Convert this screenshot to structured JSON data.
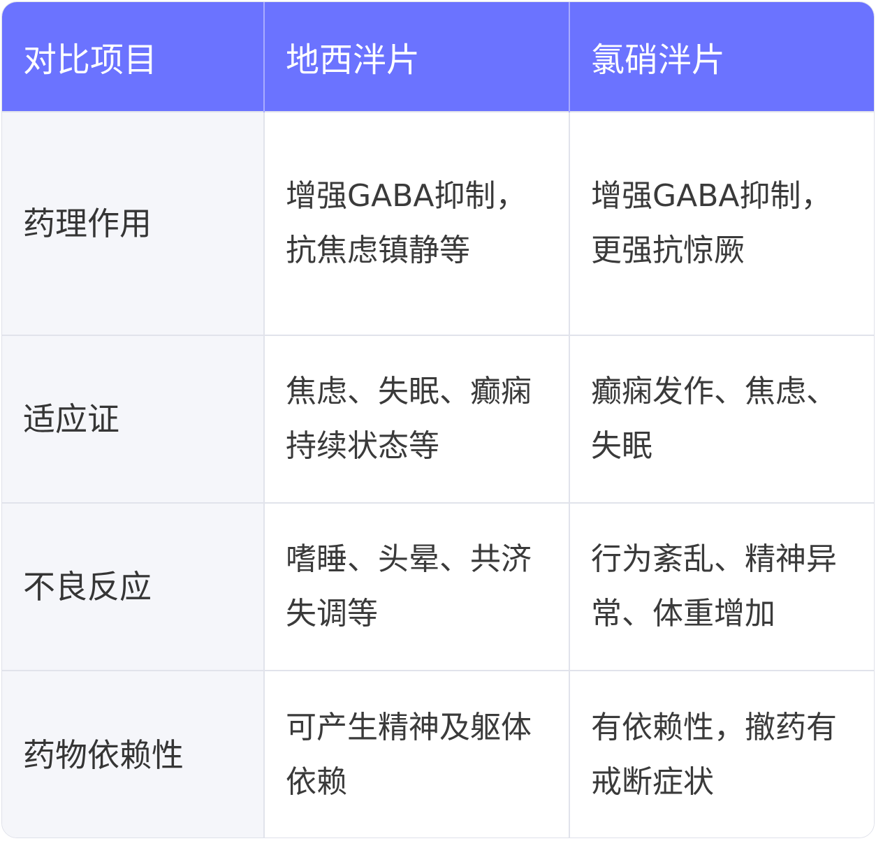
{
  "table": {
    "headers": [
      "对比项目",
      "地西泮片",
      "氯硝泮片"
    ],
    "rows": [
      {
        "label": "药理作用",
        "diazepam": "增强GABA抑制，抗焦虑镇静等",
        "clonazepam": "增强GABA抑制，更强抗惊厥"
      },
      {
        "label": "适应证",
        "diazepam": "焦虑、失眠、癫痫持续状态等",
        "clonazepam": "癫痫发作、焦虑、失眠"
      },
      {
        "label": "不良反应",
        "diazepam": "嗜睡、头晕、共济失调等",
        "clonazepam": "行为紊乱、精神异常、体重增加"
      },
      {
        "label": "药物依赖性",
        "diazepam": "可产生精神及躯体依赖",
        "clonazepam": "有依赖性，撤药有戒断症状"
      }
    ]
  },
  "colors": {
    "header_bg": "#6b73ff",
    "header_text": "#ffffff",
    "label_bg": "#f5f6fa",
    "grid_line": "#e1e3eb"
  }
}
